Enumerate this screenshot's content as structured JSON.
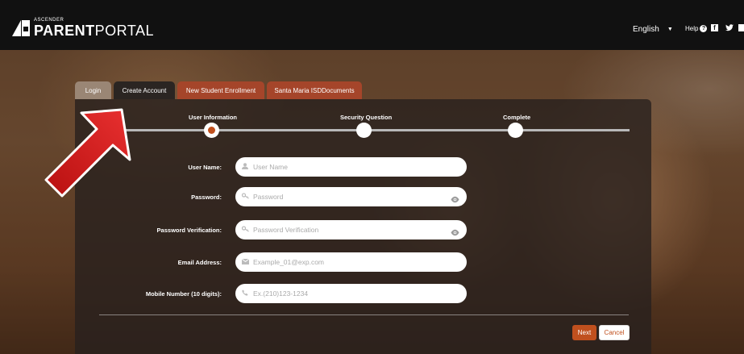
{
  "header": {
    "logo_small": "ASCENDER",
    "logo_bold": "PARENT",
    "logo_light": "PORTAL",
    "language": "English",
    "help_label": "Help"
  },
  "tabs": [
    {
      "label": "Login"
    },
    {
      "label": "Create Account"
    },
    {
      "label": "New Student Enrollment"
    },
    {
      "label": "Santa Maria ISDDocuments"
    }
  ],
  "steps": [
    {
      "label": "User Information",
      "state": "current"
    },
    {
      "label": "Security Question",
      "state": "pending"
    },
    {
      "label": "Complete",
      "state": "pending"
    }
  ],
  "form": {
    "username": {
      "label": "User Name:",
      "placeholder": "User Name",
      "icon": "user-icon"
    },
    "password": {
      "label": "Password:",
      "placeholder": "Password",
      "icon": "key-icon"
    },
    "password_verification": {
      "label": "Password Verification:",
      "placeholder": "Password Verification",
      "icon": "key-icon"
    },
    "email": {
      "label": "Email Address:",
      "placeholder": "Example_01@exp.com",
      "icon": "envelope-icon"
    },
    "mobile": {
      "label": "Mobile Number (10 digits):",
      "placeholder": "Ex.(210)123-1234",
      "icon": "phone-icon"
    }
  },
  "buttons": {
    "next": "Next",
    "cancel": "Cancel"
  },
  "colors": {
    "accent": "#c0501e",
    "header_bg": "#111111",
    "annotation_arrow": "#d42020"
  }
}
